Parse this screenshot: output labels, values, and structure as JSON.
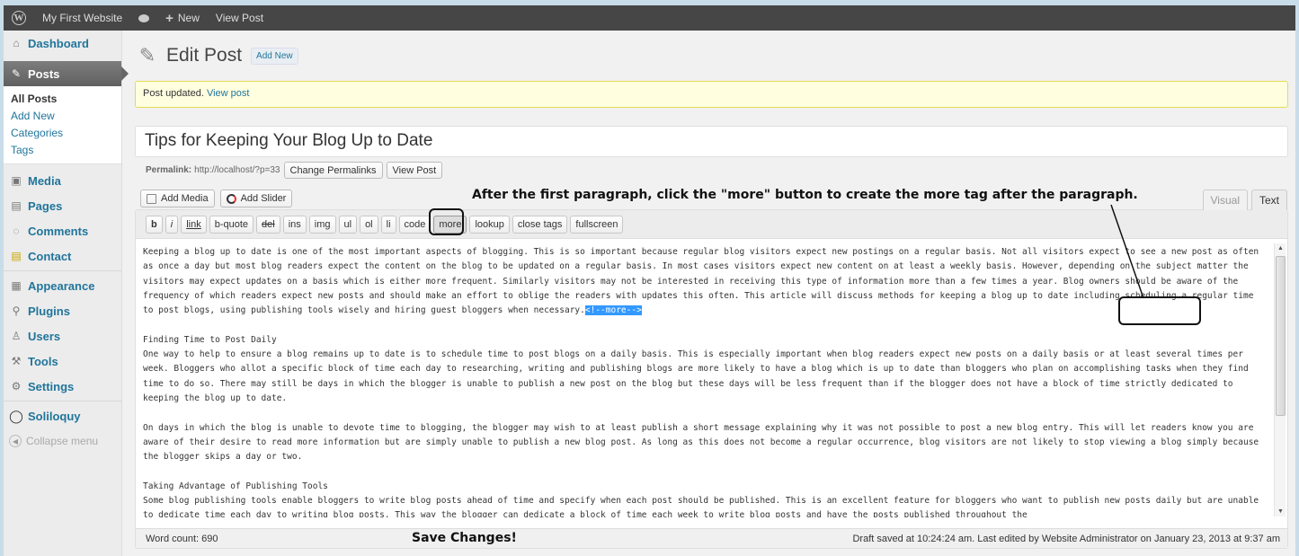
{
  "adminbar": {
    "logo_glyph": "W",
    "site_name": "My First Website",
    "new_label": "New",
    "view_post_label": "View Post"
  },
  "sidebar": {
    "dashboard": "Dashboard",
    "posts": "Posts",
    "posts_sub": [
      "All Posts",
      "Add New",
      "Categories",
      "Tags"
    ],
    "media": "Media",
    "pages": "Pages",
    "comments": "Comments",
    "contact": "Contact",
    "appearance": "Appearance",
    "plugins": "Plugins",
    "users": "Users",
    "tools": "Tools",
    "settings": "Settings",
    "soliloquy": "Soliloquy",
    "collapse": "Collapse menu"
  },
  "header": {
    "title": "Edit Post",
    "add_new": "Add New"
  },
  "notice": {
    "text": "Post updated.",
    "link": "View post"
  },
  "post": {
    "title": "Tips for Keeping Your Blog Up to Date",
    "permalink_label": "Permalink:",
    "permalink_url": "http://localhost/?p=33",
    "change_permalinks": "Change Permalinks",
    "view_post": "View Post"
  },
  "media": {
    "add_media": "Add Media",
    "add_slider": "Add Slider"
  },
  "editor_tabs": {
    "visual": "Visual",
    "text": "Text"
  },
  "toolbar": {
    "b": "b",
    "i": "i",
    "link": "link",
    "bquote": "b-quote",
    "del": "del",
    "ins": "ins",
    "img": "img",
    "ul": "ul",
    "ol": "ol",
    "li": "li",
    "code": "code",
    "more": "more",
    "lookup": "lookup",
    "close_tags": "close tags",
    "fullscreen": "fullscreen"
  },
  "content": {
    "p1": "Keeping a blog up to date is one of the most important aspects of blogging. This is so important because regular blog visitors expect new postings on a regular basis. Not all visitors expect to see a new post as often as once a day but most blog readers expect the content on the blog to be updated on a regular basis. In most cases visitors expect new content on at least a weekly basis. However, depending on the subject matter the visitors may expect updates on a basis which is either more frequent. Similarly visitors may not be interested in receiving this type of information more than a few times a year. Blog owners should be aware of the frequency of which readers expect new posts and should make an effort to oblige the readers with updates this often. This article will discuss methods for keeping a blog up to date including scheduling a regular time to post blogs, using publishing tools wisely and hiring guest bloggers when necessary.",
    "more_tag": "<!--more-->",
    "h1": "Finding Time to Post Daily",
    "p2": "One way to help to ensure a blog remains up to date is to schedule time to post blogs on a daily basis. This is especially important when blog readers expect new posts on a daily basis or at least several times per week. Bloggers who allot a specific block of time each day to researching, writing and publishing blogs are more likely to have a blog which is up to date than bloggers who plan on accomplishing tasks when they find time to do so. There may still be days in which the blogger is unable to publish a new post on the blog but these days will be less frequent than if the blogger does not have a block of time strictly dedicated to keeping the blog up to date.",
    "p3": "On days in which the blog is unable to devote time to blogging, the blogger may wish to at least publish a short message explaining why it was not possible to post a new blog entry. This will let readers know you are aware of their desire to read more information but are simply unable to publish a new blog post. As long as this does not become a regular occurrence, blog visitors are not likely to stop viewing a blog simply because the blogger skips a day or two.",
    "h2": "Taking Advantage of Publishing Tools",
    "p4": "Some blog publishing tools enable bloggers to write blog posts ahead of time and specify when each post should be published. This is an excellent feature for bloggers who want to publish new posts daily but are unable to dedicate time each day to writing blog posts. This way the blogger can dedicate a block of time each week to write blog posts and have the posts published throughout the"
  },
  "status": {
    "word_count": "Word count: 690",
    "draft_saved": "Draft saved at 10:24:24 am. Last edited by Website Administrator on January 23, 2013 at 9:37 am"
  },
  "annotations": {
    "instruction": "After the first paragraph, click the \"more\" button to create the more tag after the paragraph.",
    "save": "Save Changes!"
  }
}
